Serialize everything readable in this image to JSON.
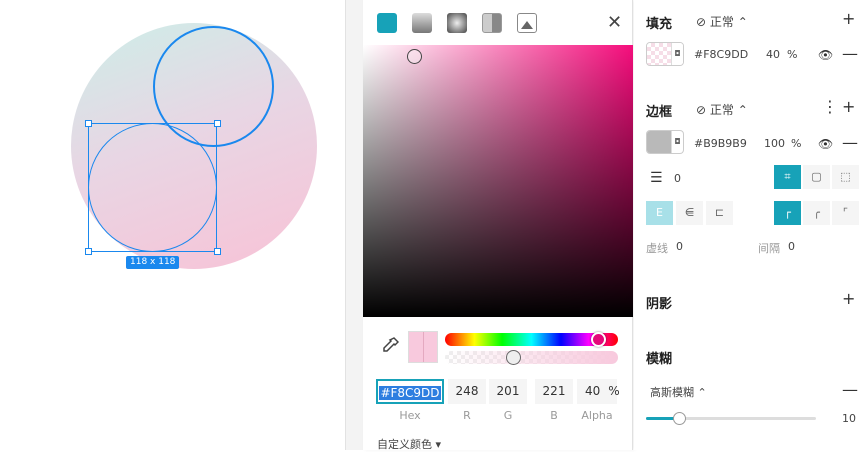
{
  "canvas": {
    "size_label": "118 x 118"
  },
  "picker": {
    "hex": "#F8C9DD",
    "r": "248",
    "g": "201",
    "b": "221",
    "alpha": "40",
    "alpha_unit": "%",
    "labels": {
      "hex": "Hex",
      "r": "R",
      "g": "G",
      "b": "B",
      "alpha": "Alpha"
    },
    "custom_colors": "自定义颜色 ▾",
    "close": "✕",
    "colors": {
      "accent": "#17a2b8",
      "hue": "#f50d7c"
    }
  },
  "panel": {
    "fill": {
      "title": "填充",
      "blend": "正常",
      "hex": "#F8C9DD",
      "opacity": "40",
      "unit": "%"
    },
    "border": {
      "title": "边框",
      "blend": "正常",
      "hex": "#B9B9B9",
      "opacity": "100",
      "unit": "%",
      "width": "0",
      "dash_label": "虚线",
      "dash": "0",
      "gap_label": "间隔",
      "gap": "0"
    },
    "shadow": {
      "title": "阴影"
    },
    "blur": {
      "title": "模糊",
      "type": "高斯模糊",
      "value": "10"
    }
  }
}
